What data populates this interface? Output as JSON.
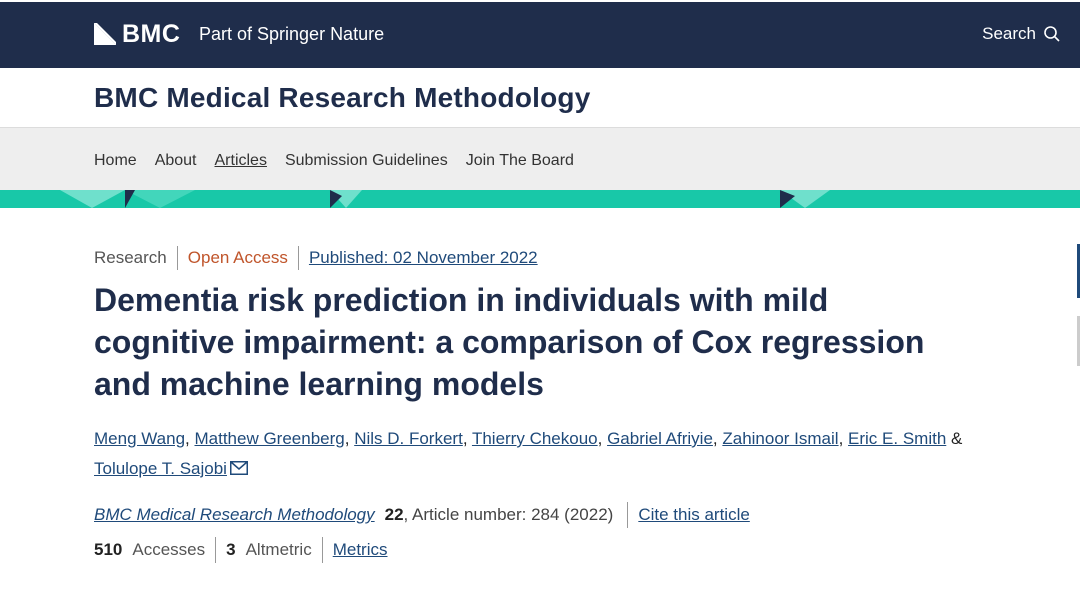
{
  "brand": {
    "logo_text": "BMC",
    "part_of": "Part of Springer Nature",
    "search_label": "Search"
  },
  "journal": {
    "title": "BMC Medical Research Methodology"
  },
  "nav": {
    "items": [
      {
        "label": "Home"
      },
      {
        "label": "About"
      },
      {
        "label": "Articles"
      },
      {
        "label": "Submission Guidelines"
      },
      {
        "label": "Join The Board"
      }
    ],
    "active_index": 2
  },
  "article": {
    "type": "Research",
    "access": "Open Access",
    "published": "Published: 02 November 2022",
    "title": "Dementia risk prediction in individuals with mild cognitive impairment: a comparison of Cox regression and machine learning models",
    "authors": [
      "Meng Wang",
      "Matthew Greenberg",
      "Nils D. Forkert",
      "Thierry Chekouo",
      "Gabriel Afriyie",
      "Zahinoor Ismail",
      "Eric E. Smith",
      "Tolulope T. Sajobi"
    ],
    "author_joiner": "&",
    "citation": {
      "journal": "BMC Medical Research Methodology",
      "volume": "22",
      "rest": ", Article number: 284 (2022)",
      "cite_label": "Cite this article"
    },
    "metrics": {
      "accesses_value": "510",
      "accesses_label": "Accesses",
      "altmetric_value": "3",
      "altmetric_label": "Altmetric",
      "metrics_link": "Metrics"
    }
  },
  "colors": {
    "header_bg": "#1f2d4b",
    "accent_teal": "#18c8a8",
    "open_access": "#c0552b",
    "link": "#1f4a7a"
  }
}
